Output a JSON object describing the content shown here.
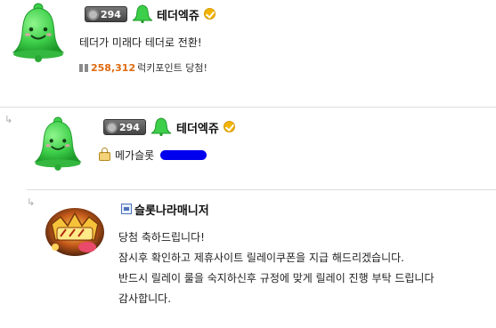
{
  "comments": [
    {
      "level": "294",
      "nickname": "테더엑쥬",
      "text": "테더가 미래다 테더로 전환!",
      "points_value": "258,312",
      "points_label": "럭키포인트 당첨!"
    },
    {
      "level": "294",
      "nickname": "테더엑쥬",
      "text": "메가슬롯"
    },
    {
      "nickname": "슬롯나라매니저",
      "lines": [
        "당첨 축하드립니다!",
        "잠시후 확인하고 제휴사이트 릴레이쿠폰을 지급 해드리겠습니다.",
        "반드시 릴레이 룰을 숙지하신후 규정에 맞게 릴레이 진행 부탁 드립니다",
        "감사합니다."
      ]
    }
  ],
  "colors": {
    "points": "#e06a10",
    "bell": "#3ecf4a",
    "redaction": "#0000ee"
  },
  "icons": {
    "profile": "green-bell-icon",
    "level": "gear-badge-icon",
    "verified": "verified-check-icon",
    "reply": "reply-arrow-icon",
    "lock": "lock-icon",
    "manager": "manager-icon",
    "points": "gift-icon"
  }
}
